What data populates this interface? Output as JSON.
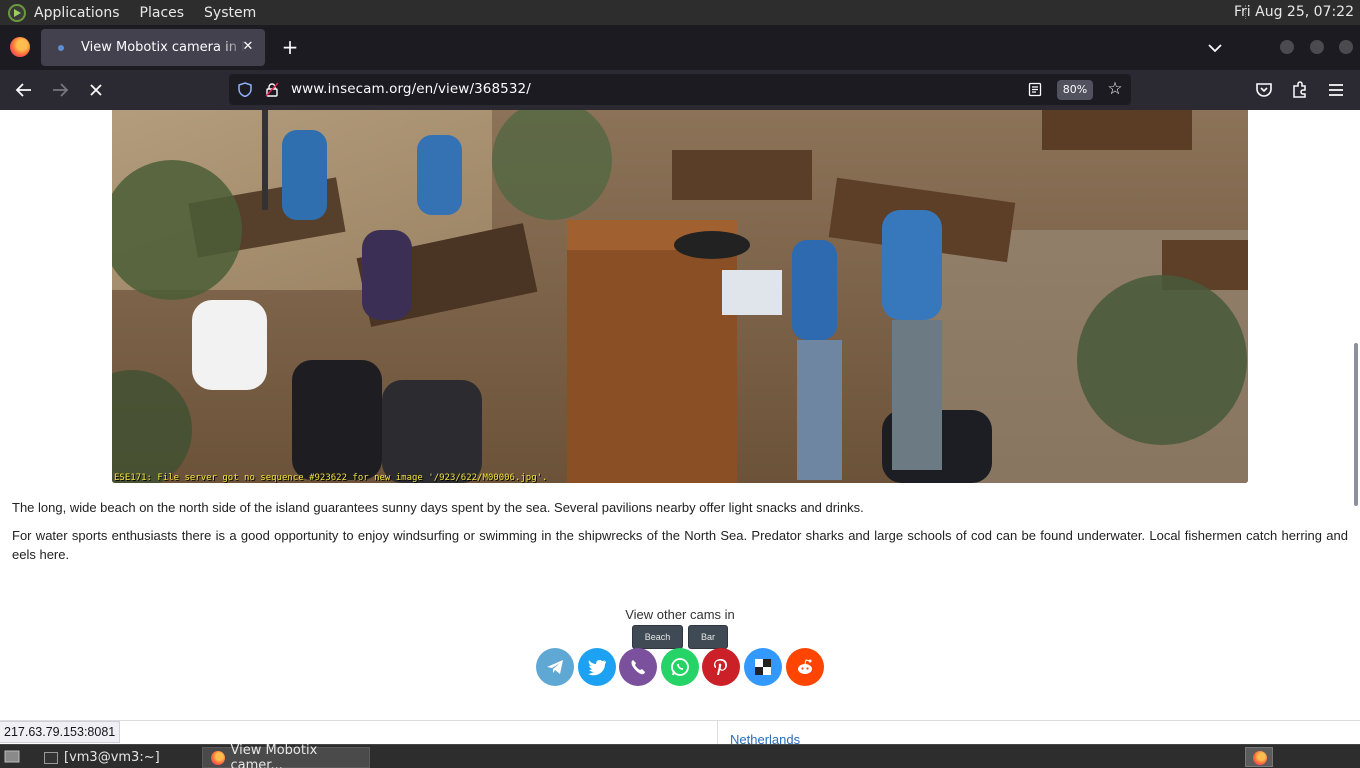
{
  "panel": {
    "applications": "Applications",
    "places": "Places",
    "system": "System",
    "clock": "Fri Aug 25, 07:22"
  },
  "browser": {
    "tab_title": "View Mobotix camera in Netherlands",
    "url": "www.insecam.org/en/view/368532/",
    "zoom": "80%"
  },
  "page": {
    "camera_overlay": "ESE171: File server got no sequence #923622 for new image '/923/622/M00006.jpg'.",
    "paragraph1": "The long, wide beach on the north side of the island guarantees sunny days spent by the sea. Several pavilions nearby offer light snacks and drinks.",
    "paragraph2": "For water sports enthusiasts there is a good opportunity to enjoy windsurfing or swimming in the shipwrecks of the North Sea. Predator sharks and large schools of cod can be found underwater. Local fishermen catch herring and eels here.",
    "view_other": "View other cams in",
    "tags": [
      "Beach",
      "Bar"
    ],
    "share": [
      {
        "name": "telegram-icon",
        "color": "#5fa8d3"
      },
      {
        "name": "twitter-icon",
        "color": "#1da1f2"
      },
      {
        "name": "viber-icon",
        "color": "#7b519d"
      },
      {
        "name": "whatsapp-icon",
        "color": "#25d366"
      },
      {
        "name": "pinterest-icon",
        "color": "#cb2027"
      },
      {
        "name": "delicious-icon",
        "color": "#3399ff"
      },
      {
        "name": "reddit-icon",
        "color": "#ff4500"
      }
    ],
    "country_link": "Netherlands"
  },
  "status_url": "217.63.79.153:8081",
  "taskbar": {
    "terminal": "[vm3@vm3:~]",
    "firefox": "View Mobotix camer..."
  }
}
